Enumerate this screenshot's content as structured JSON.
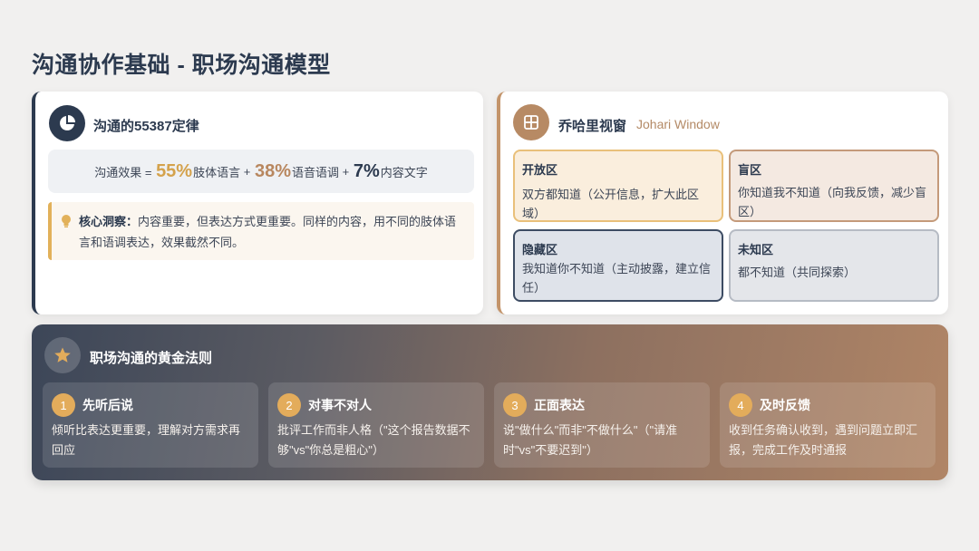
{
  "page": {
    "title": "沟通协作基础 - 职场沟通模型"
  },
  "rule_55387": {
    "title": "沟通的55387定律",
    "icon": "pie-chart-icon",
    "formula": {
      "prefix": "沟通效果 = ",
      "p1": "55%",
      "l1": "肢体语言",
      "plus1": " + ",
      "p2": "38%",
      "l2": "语音语调",
      "plus2": " + ",
      "p3": "7%",
      "l3": "内容文字"
    },
    "insight": {
      "icon": "lightbulb-icon",
      "label": "核心洞察：",
      "text": "内容重要，但表达方式更重要。同样的内容，用不同的肢体语言和语调表达，效果截然不同。"
    }
  },
  "johari": {
    "title": "乔哈里视窗",
    "subtitle": "Johari Window",
    "icon": "grid-window-icon",
    "quadrants": {
      "open": {
        "title": "开放区",
        "text": "双方都知道（公开信息，扩大此区域）"
      },
      "blind": {
        "title": "盲区",
        "text": "你知道我不知道（向我反馈，减少盲区）"
      },
      "hidden": {
        "title": "隐藏区",
        "text": "我知道你不知道（主动披露，建立信任）"
      },
      "unknown": {
        "title": "未知区",
        "text": "都不知道（共同探索）"
      }
    }
  },
  "golden_rules": {
    "title": "职场沟通的黄金法则",
    "icon": "star-icon",
    "items": [
      {
        "num": "1",
        "title": "先听后说",
        "text": "倾听比表达更重要，理解对方需求再回应"
      },
      {
        "num": "2",
        "title": "对事不对人",
        "text": "批评工作而非人格（\"这个报告数据不够\"vs\"你总是粗心\"）"
      },
      {
        "num": "3",
        "title": "正面表达",
        "text": "说\"做什么\"而非\"不做什么\"（\"请准时\"vs\"不要迟到\"）"
      },
      {
        "num": "4",
        "title": "及时反馈",
        "text": "收到任务确认收到，遇到问题立即汇报，完成工作及时通报"
      }
    ]
  },
  "colors": {
    "navy": "#2c3a4f",
    "gold": "#d4a24c",
    "tan": "#b8875f",
    "background": "#f1f0ef"
  }
}
